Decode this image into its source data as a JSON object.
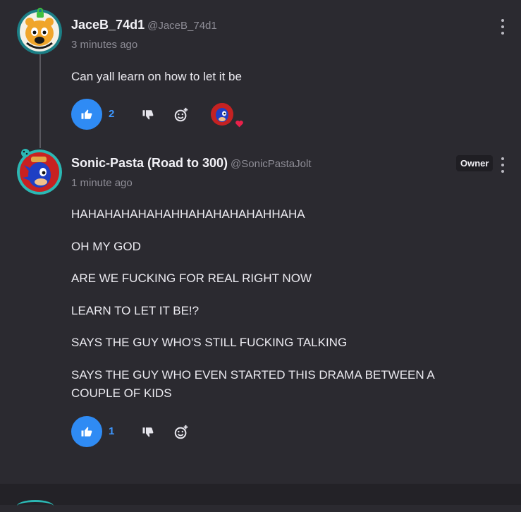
{
  "comments": [
    {
      "username": "JaceB_74d1",
      "handle": "@JaceB_74d1",
      "time": "3 minutes ago",
      "lines": [
        "Can yall learn on how to let it be"
      ],
      "likes": "2",
      "has_reaction": true
    },
    {
      "username": "Sonic-Pasta (Road to 300)",
      "handle": "@SonicPastaJolt",
      "time": "1 minute ago",
      "badge": "Owner",
      "lines": [
        "HAHAHAHAHAHAHHAHAHAHAHAHHAHA",
        "OH MY GOD",
        "ARE WE FUCKING FOR REAL RIGHT NOW",
        "LEARN TO LET IT BE!?",
        "SAYS THE GUY WHO'S STILL FUCKING TALKING",
        "SAYS THE GUY WHO EVEN STARTED THIS DRAMA BETWEEN A COUPLE OF KIDS"
      ],
      "likes": "1"
    }
  ],
  "icons": {
    "like": "thumbs-up-icon",
    "dislike": "thumbs-down-icon",
    "react": "add-emoji-icon",
    "menu": "more-vertical-icon",
    "heart": "heart-icon"
  },
  "colors": {
    "background": "#2b2a30",
    "accent": "#2f8bf4",
    "like_count": "#3d97ff",
    "heart": "#e8214a",
    "avatar_ring": "#2bb8b4"
  }
}
